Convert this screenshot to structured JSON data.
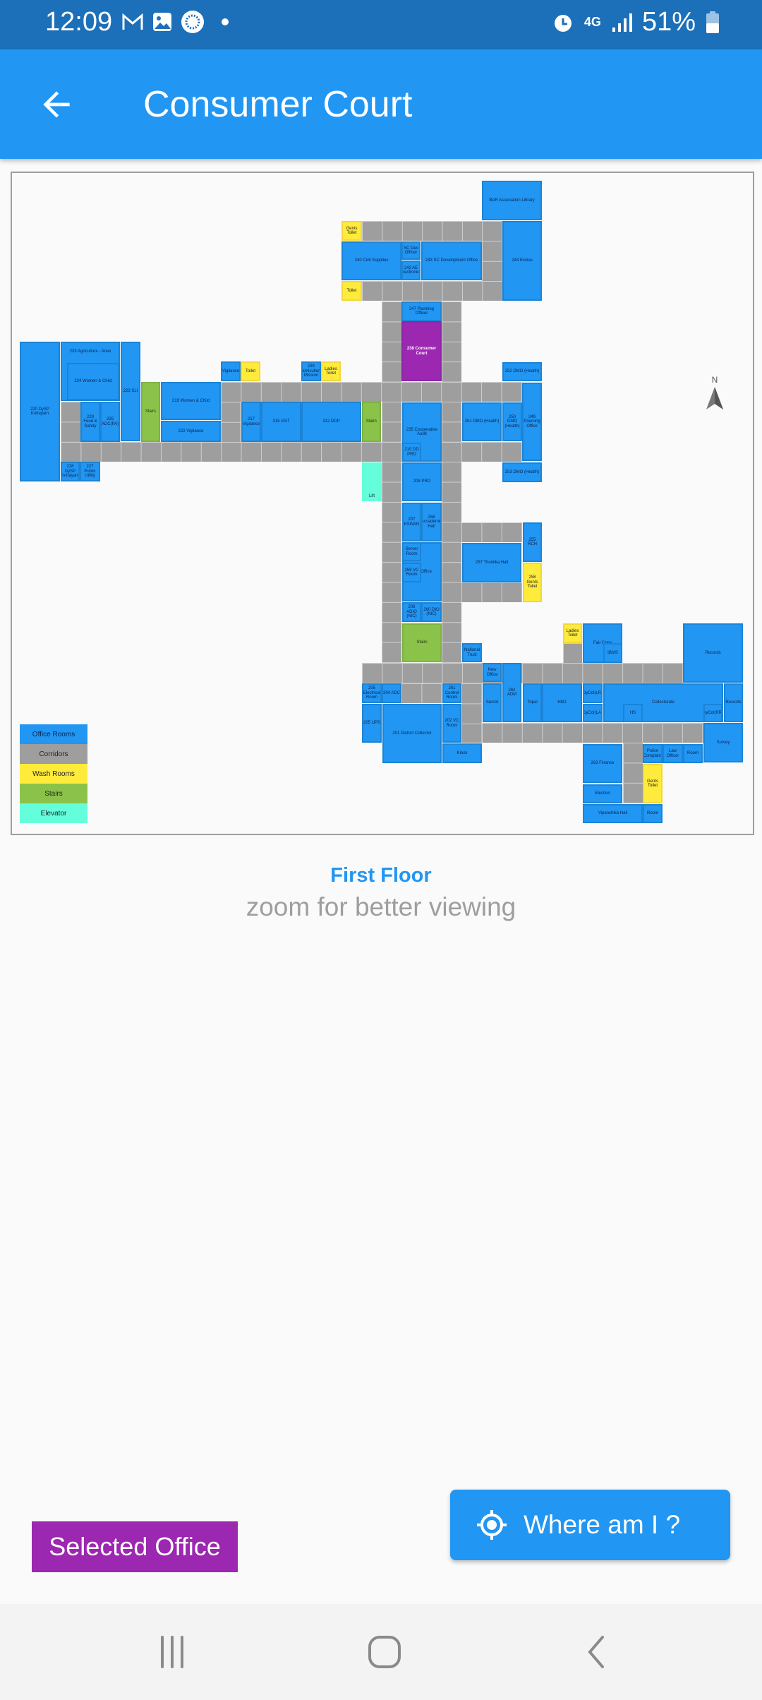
{
  "status_bar": {
    "time": "12:09",
    "network": "4G",
    "battery": "51%",
    "icons": [
      "gmail-icon",
      "gallery-icon",
      "app-icon",
      "dot-icon",
      "alarm-icon",
      "signal-icon",
      "battery-icon"
    ]
  },
  "app_bar": {
    "title": "Consumer Court",
    "back_icon": "arrow-left-icon"
  },
  "colors": {
    "office": "#2196f3",
    "corridor": "#9e9e9e",
    "washroom": "#ffeb3b",
    "stairs": "#8bc34a",
    "elevator": "#64ffda",
    "selected": "#9c27b0"
  },
  "map": {
    "compass": "N",
    "legend": [
      "Office Rooms",
      "Corridors",
      "Wash Rooms",
      "Stairs",
      "Elevator"
    ],
    "rooms": [
      {
        "label": "220 DySP Kottayam",
        "type": "office"
      },
      {
        "label": "233 Agriculture - Anex",
        "type": "office"
      },
      {
        "label": "224 Women & Child",
        "type": "office"
      },
      {
        "label": "223 SLI",
        "type": "office"
      },
      {
        "label": "229 Food & Safety",
        "type": "office"
      },
      {
        "label": "225 ADC(PA)",
        "type": "office"
      },
      {
        "label": "228 DySP Kottayam",
        "type": "office"
      },
      {
        "label": "227 Public Utility",
        "type": "office"
      },
      {
        "label": "219 Women & Child",
        "type": "office"
      },
      {
        "label": "222 Vigilance",
        "type": "office"
      },
      {
        "label": "Vigilance",
        "type": "office"
      },
      {
        "label": "217 Vigilance",
        "type": "office"
      },
      {
        "label": "315 GST",
        "type": "office"
      },
      {
        "label": "312 DDP",
        "type": "office"
      },
      {
        "label": "234 Horticulture Mission",
        "type": "office"
      },
      {
        "label": "BAR Association Library",
        "type": "office"
      },
      {
        "label": "240 Civil Supplies",
        "type": "office"
      },
      {
        "label": "SC Dev Officer",
        "type": "office"
      },
      {
        "label": "242 AE (Electronics)",
        "type": "office"
      },
      {
        "label": "243 SC Development Office",
        "type": "office"
      },
      {
        "label": "244 Excise",
        "type": "office"
      },
      {
        "label": "247 Planning Officer",
        "type": "office"
      },
      {
        "label": "238 Consumer Court",
        "type": "selected"
      },
      {
        "label": "252 DMO (Health)",
        "type": "office"
      },
      {
        "label": "249 Planning Office",
        "type": "office"
      },
      {
        "label": "235 Cooperative Audit",
        "type": "office"
      },
      {
        "label": "210 DD PRD",
        "type": "office"
      },
      {
        "label": "251 DMO (Health)",
        "type": "office"
      },
      {
        "label": "250 DMO (Health)",
        "type": "office"
      },
      {
        "label": "253 DMO (Health)",
        "type": "office"
      },
      {
        "label": "208 PRD",
        "type": "office"
      },
      {
        "label": "207 KSWAN",
        "type": "office"
      },
      {
        "label": "256 Accademic Hall",
        "type": "office"
      },
      {
        "label": "NIC Office",
        "type": "office"
      },
      {
        "label": "Server Room",
        "type": "office"
      },
      {
        "label": "259 VC Room",
        "type": "office"
      },
      {
        "label": "206 ADIO (NIC)",
        "type": "office"
      },
      {
        "label": "260 DIO (NIC)",
        "type": "office"
      },
      {
        "label": "255 RCH",
        "type": "office"
      },
      {
        "label": "257 Thoolika Hall",
        "type": "office"
      },
      {
        "label": "National Trust",
        "type": "office"
      },
      {
        "label": "205 Electrical Room",
        "type": "office"
      },
      {
        "label": "204 ADC",
        "type": "office"
      },
      {
        "label": "261 Control Room",
        "type": "office"
      },
      {
        "label": "205 UPS",
        "type": "office"
      },
      {
        "label": "201 District Collector",
        "type": "office"
      },
      {
        "label": "202 VC Room",
        "type": "office"
      },
      {
        "label": "Kiosk",
        "type": "office"
      },
      {
        "label": "New Office",
        "type": "office"
      },
      {
        "label": "Secret",
        "type": "office"
      },
      {
        "label": "262 ADM",
        "type": "office"
      },
      {
        "label": "Fair Copy",
        "type": "office"
      },
      {
        "label": "IBMS",
        "type": "office"
      },
      {
        "label": "Records",
        "type": "office"
      },
      {
        "label": "Topal",
        "type": "office"
      },
      {
        "label": "HMJ",
        "type": "office"
      },
      {
        "label": "DyCol(LR)",
        "type": "office"
      },
      {
        "label": "DyCol(LA)",
        "type": "office"
      },
      {
        "label": "Collectorate",
        "type": "office"
      },
      {
        "label": "HS",
        "type": "office"
      },
      {
        "label": "DyCol(RR)",
        "type": "office"
      },
      {
        "label": "Records",
        "type": "office"
      },
      {
        "label": "Survey",
        "type": "office"
      },
      {
        "label": "263 Finance",
        "type": "office"
      },
      {
        "label": "Police Complaint",
        "type": "office"
      },
      {
        "label": "Law Officer",
        "type": "office"
      },
      {
        "label": "Room",
        "type": "office"
      },
      {
        "label": "Election",
        "type": "office"
      },
      {
        "label": "Vipanchika Hall",
        "type": "office"
      },
      {
        "label": "Room",
        "type": "office"
      },
      {
        "label": "Toilet",
        "type": "washroom"
      },
      {
        "label": "Ladies Toilet",
        "type": "washroom"
      },
      {
        "label": "Gents Toilet",
        "type": "washroom"
      },
      {
        "label": "Toilet",
        "type": "washroom"
      },
      {
        "label": "258 Gents Toilet",
        "type": "washroom"
      },
      {
        "label": "Ladies Toilet",
        "type": "washroom"
      },
      {
        "label": "Gents Toilet",
        "type": "washroom"
      },
      {
        "label": "Stairs",
        "type": "stairs"
      },
      {
        "label": "Stairs",
        "type": "stairs"
      },
      {
        "label": "Stairs",
        "type": "stairs"
      },
      {
        "label": "Lift",
        "type": "elevator"
      }
    ]
  },
  "floor": {
    "name": "First Floor",
    "hint": "zoom for better viewing"
  },
  "selected_key": "Selected Office",
  "where_button": {
    "label": "Where am I ?",
    "icon": "crosshair-icon"
  },
  "nav_bar": {
    "icons": [
      "recent-apps-icon",
      "home-icon",
      "back-icon"
    ]
  }
}
